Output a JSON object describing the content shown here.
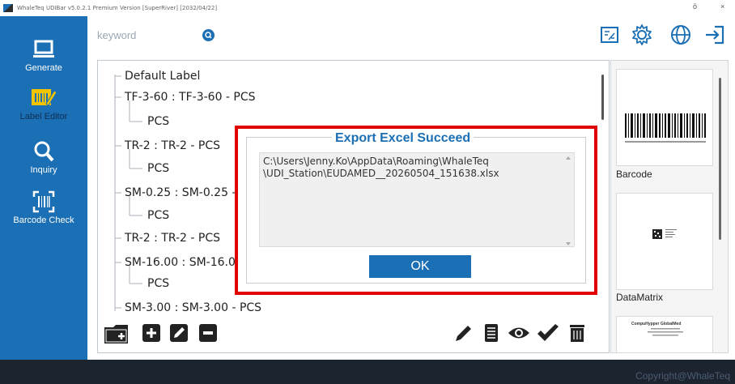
{
  "window": {
    "title": "WhaleTeq UDIBar v5.0.2.1    Premium Version   [SuperRiver]   [2032/04/22]",
    "minimize": "ō",
    "close": "×"
  },
  "sidebar": {
    "items": [
      {
        "label": "Generate",
        "icon": "laptop-icon"
      },
      {
        "label": "Label Editor",
        "icon": "label-edit-icon"
      },
      {
        "label": "Inquiry",
        "icon": "search-icon"
      },
      {
        "label": "Barcode Check",
        "icon": "barcode-scan-icon"
      }
    ]
  },
  "search": {
    "placeholder": "keyword"
  },
  "tree": {
    "nodes": [
      {
        "text": "Default Label"
      },
      {
        "text": "TF-3-60 : TF-3-60 - PCS"
      },
      {
        "text": "PCS"
      },
      {
        "text": "TR-2 : TR-2 - PCS"
      },
      {
        "text": "PCS"
      },
      {
        "text": "SM-0.25 : SM-0.25 - P"
      },
      {
        "text": "PCS"
      },
      {
        "text": "TR-2 : TR-2 - PCS"
      },
      {
        "text": "SM-16.00 : SM-16.00"
      },
      {
        "text": "PCS"
      },
      {
        "text": "SM-3.00 : SM-3.00 - PCS"
      }
    ]
  },
  "templates": [
    {
      "label": "Barcode"
    },
    {
      "label": "DataMatrix"
    },
    {
      "label": "",
      "preview_title": "CompuHypper GlobalMed"
    }
  ],
  "dialog": {
    "title": "Export Excel Succeed",
    "message": "C:\\Users\\Jenny.Ko\\AppData\\Roaming\\WhaleTeq\n\\UDI_Station\\EUDAMED__20260504_151638.xlsx",
    "ok_label": "OK"
  },
  "footer": {
    "copyright": "Copyright@WhaleTeq"
  },
  "colors": {
    "accent": "#1b6fb4",
    "highlight": "#e10000",
    "footer": "#1c2430"
  }
}
